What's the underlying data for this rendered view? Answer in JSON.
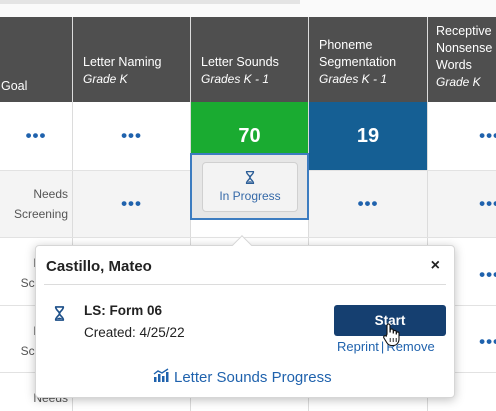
{
  "columns": [
    {
      "name": "Goal",
      "sub": ""
    },
    {
      "name": "Letter Naming",
      "sub": "Grade K"
    },
    {
      "name": "Letter Sounds",
      "sub": "Grades K - 1"
    },
    {
      "name": "Phoneme Segmentation",
      "sub": "Grades K - 1"
    },
    {
      "name": "Receptive Nonsense Words",
      "sub": "Grade K"
    }
  ],
  "header_lines": {
    "phoneme_1": "Phoneme",
    "phoneme_2": "Segmentation",
    "receptive_1": "Receptive",
    "receptive_2": "Nonsense",
    "receptive_3": "Words"
  },
  "row1": {
    "more": "•••",
    "letter_sounds_score": "70",
    "phoneme_score": "19",
    "colors": {
      "green": "#1aab31",
      "blue": "#155f94"
    }
  },
  "row2": {
    "needs_1": "Needs",
    "needs_2": "Screening",
    "in_progress": "In Progress",
    "more": "•••"
  },
  "row3": {
    "needs_1": "Needs",
    "needs_2": "Screenin"
  },
  "row4": {
    "needs_1": "Needs",
    "needs_2": "Screenin"
  },
  "row5": {
    "needs_1": "Needs"
  },
  "popup": {
    "student": "Castillo, Mateo",
    "close": "×",
    "form": "LS: Form 06",
    "created": "Created: 4/25/22",
    "start": "Start",
    "reprint": "Reprint",
    "separator": "|",
    "remove": "Remove",
    "progress_link": "Letter Sounds Progress",
    "icons": [
      "hourglass-icon",
      "chart-icon",
      "hand-cursor-icon",
      "close-icon"
    ]
  }
}
